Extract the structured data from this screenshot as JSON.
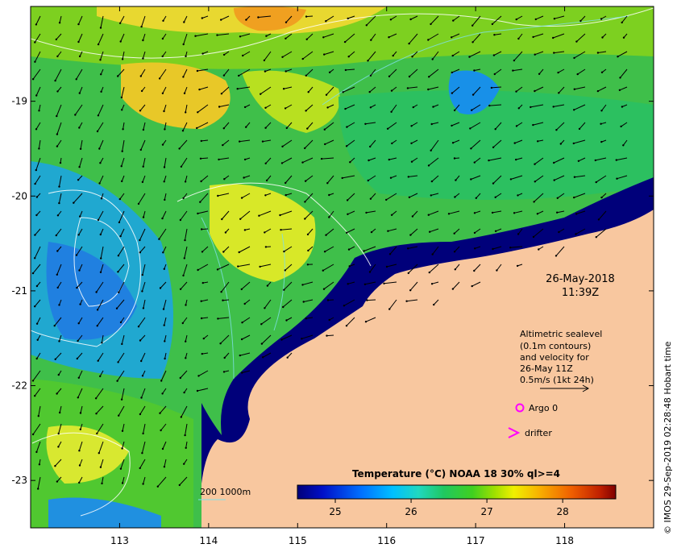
{
  "map": {
    "date": "26-May-2018",
    "time": "11:39Z",
    "x_ticks": [
      "113",
      "114",
      "115",
      "116",
      "117",
      "118"
    ],
    "y_ticks": [
      "-19",
      "-20",
      "-21",
      "-22",
      "-23"
    ],
    "lon_range": [
      112.0,
      119.0
    ],
    "lat_range": [
      -23.5,
      -18.0
    ],
    "colors": {
      "land": "#f8c79f",
      "shelf_dark": "#00007a",
      "contour_white": "#ffffff",
      "contour_cyan": "#7fe0e8",
      "argo": "#ff00ff",
      "drifter": "#ff00ff"
    }
  },
  "info": {
    "line1": "Altimetric sealevel",
    "line2": "(0.1m contours)",
    "line3": "and velocity for",
    "line4": "26-May 11Z",
    "scale_label": "0.5m/s (1kt 24h)"
  },
  "markers": {
    "argo_label": "Argo 0",
    "drifter_label": "drifter"
  },
  "isobath": {
    "label": "200  1000m"
  },
  "colorbar": {
    "title": "Temperature (°C) NOAA 18 30% ql>=4",
    "ticks": [
      "25",
      "26",
      "27",
      "28"
    ],
    "min": 24.5,
    "max": 28.7,
    "tick_values": [
      25,
      26,
      27,
      28
    ]
  },
  "credit": "© IMOS 29-Sep-2019 02:28:48 Hobart time"
}
